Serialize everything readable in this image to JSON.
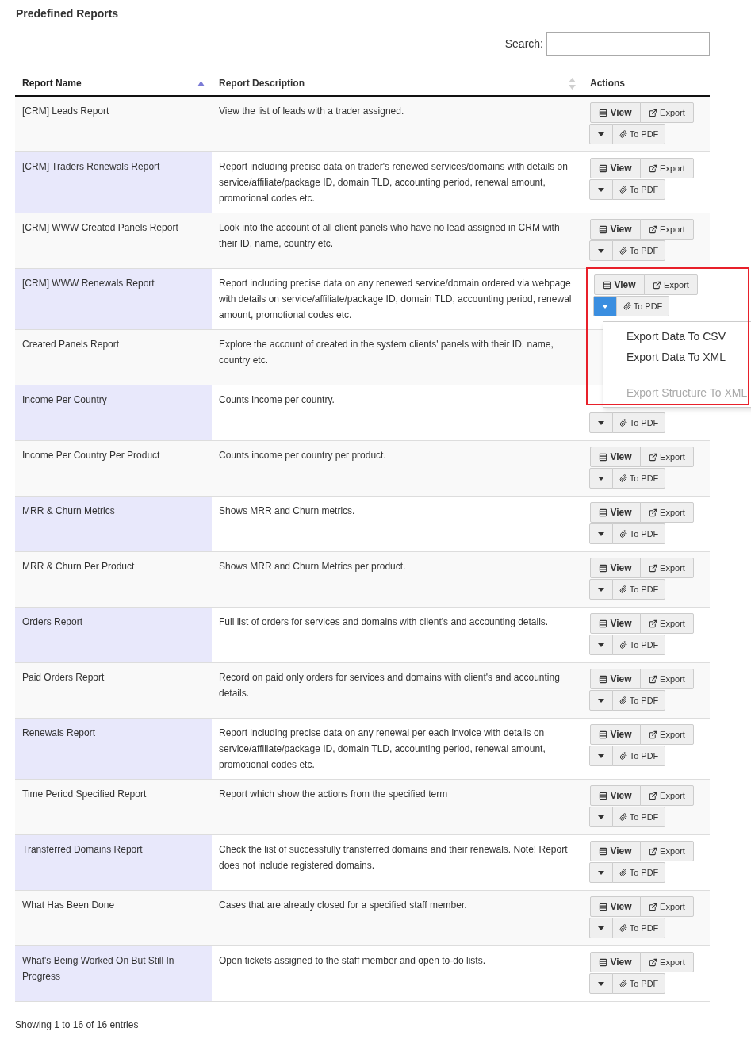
{
  "title": "Predefined Reports",
  "search": {
    "label": "Search:"
  },
  "columns": [
    {
      "label": "Report Name",
      "sortable": true,
      "sorted": true
    },
    {
      "label": "Report Description",
      "sortable": true,
      "sorted": false
    },
    {
      "label": "Actions"
    }
  ],
  "rows": [
    {
      "name": "[CRM] Leads Report",
      "description": "View the list of leads with a trader assigned.",
      "buttons": [
        {
          "kind": "view",
          "label": "View"
        },
        {
          "kind": "export",
          "label": "Export"
        },
        {
          "kind": "toggle"
        },
        {
          "kind": "pdf",
          "label": "To PDF"
        }
      ]
    },
    {
      "name": "[CRM] Traders Renewals Report",
      "description": "Report including precise data on trader's renewed services/domains with details on service/affiliate/package ID, domain TLD, accounting period, renewal amount, promotional codes etc.",
      "buttons": [
        {
          "kind": "view",
          "label": "View"
        },
        {
          "kind": "export",
          "label": "Export"
        },
        {
          "kind": "toggle"
        },
        {
          "kind": "pdf",
          "label": "To PDF"
        }
      ]
    },
    {
      "name": "[CRM] WWW Created Panels Report",
      "description": "Look into the account of all client panels who have no lead assigned in CRM with their ID, name, country etc.",
      "buttons": [
        {
          "kind": "view",
          "label": "View"
        },
        {
          "kind": "export",
          "label": "Export"
        },
        {
          "kind": "toggle"
        },
        {
          "kind": "pdf",
          "label": "To PDF"
        }
      ]
    },
    {
      "name": "[CRM] WWW Renewals Report",
      "description": "Report including precise data on any renewed service/domain ordered via webpage with details on service/affiliate/package ID, domain TLD, accounting period, renewal amount, promotional codes etc.",
      "dropdown_open": true,
      "buttons": [
        {
          "kind": "view",
          "label": "View"
        },
        {
          "kind": "export",
          "label": "Export"
        },
        {
          "kind": "toggle"
        },
        {
          "kind": "pdf",
          "label": "To PDF"
        }
      ],
      "menu": [
        {
          "label": "Export Data To CSV",
          "disabled": false
        },
        {
          "label": "Export Data To XML",
          "disabled": false
        },
        {
          "label": "Export Structure To XML",
          "disabled": true
        }
      ]
    },
    {
      "name": "Created Panels Report",
      "description": "Explore the account of created in the system clients' panels with their ID, name, country etc.",
      "buttons": []
    },
    {
      "name": "Income Per Country",
      "description": "Counts income per country.",
      "buttons": [
        {
          "kind": "toggle"
        },
        {
          "kind": "pdf",
          "label": "To PDF"
        }
      ]
    },
    {
      "name": "Income Per Country Per Product",
      "description": "Counts income per country per product.",
      "buttons": [
        {
          "kind": "view",
          "label": "View"
        },
        {
          "kind": "export",
          "label": "Export"
        },
        {
          "kind": "toggle"
        },
        {
          "kind": "pdf",
          "label": "To PDF"
        }
      ]
    },
    {
      "name": "MRR & Churn Metrics",
      "description": "Shows MRR and Churn metrics.",
      "buttons": [
        {
          "kind": "view",
          "label": "View"
        },
        {
          "kind": "export",
          "label": "Export"
        },
        {
          "kind": "toggle"
        },
        {
          "kind": "pdf",
          "label": "To PDF"
        }
      ]
    },
    {
      "name": "MRR & Churn Per Product",
      "description": "Shows MRR and Churn Metrics per product.",
      "buttons": [
        {
          "kind": "view",
          "label": "View"
        },
        {
          "kind": "export",
          "label": "Export"
        },
        {
          "kind": "toggle"
        },
        {
          "kind": "pdf",
          "label": "To PDF"
        }
      ]
    },
    {
      "name": "Orders Report",
      "description": "Full list of orders for services and domains with client's and accounting details.",
      "buttons": [
        {
          "kind": "view",
          "label": "View"
        },
        {
          "kind": "export",
          "label": "Export"
        },
        {
          "kind": "toggle"
        },
        {
          "kind": "pdf",
          "label": "To PDF"
        }
      ]
    },
    {
      "name": "Paid Orders Report",
      "description": "Record on paid only orders for services and domains with client's and accounting details.",
      "buttons": [
        {
          "kind": "view",
          "label": "View"
        },
        {
          "kind": "export",
          "label": "Export"
        },
        {
          "kind": "toggle"
        },
        {
          "kind": "pdf",
          "label": "To PDF"
        }
      ]
    },
    {
      "name": "Renewals Report",
      "description": "Report including precise data on any renewal per each invoice with details on service/affiliate/package ID, domain TLD, accounting period, renewal amount, promotional codes etc.",
      "buttons": [
        {
          "kind": "view",
          "label": "View"
        },
        {
          "kind": "export",
          "label": "Export"
        },
        {
          "kind": "toggle"
        },
        {
          "kind": "pdf",
          "label": "To PDF"
        }
      ]
    },
    {
      "name": "Time Period Specified Report",
      "description": "Report which show the actions from the specified term",
      "buttons": [
        {
          "kind": "view",
          "label": "View"
        },
        {
          "kind": "export",
          "label": "Export"
        },
        {
          "kind": "toggle"
        },
        {
          "kind": "pdf",
          "label": "To PDF"
        }
      ]
    },
    {
      "name": "Transferred Domains Report",
      "description": "Check the list of successfully transferred domains and their renewals. Note! Report does not include registered domains.",
      "buttons": [
        {
          "kind": "view",
          "label": "View"
        },
        {
          "kind": "export",
          "label": "Export"
        },
        {
          "kind": "toggle"
        },
        {
          "kind": "pdf",
          "label": "To PDF"
        }
      ]
    },
    {
      "name": "What Has Been Done",
      "description": "Cases that are already closed for a specified staff member.",
      "buttons": [
        {
          "kind": "view",
          "label": "View"
        },
        {
          "kind": "export",
          "label": "Export"
        },
        {
          "kind": "toggle"
        },
        {
          "kind": "pdf",
          "label": "To PDF"
        }
      ]
    },
    {
      "name": "What's Being Worked On But Still In Progress",
      "description": "Open tickets assigned to the staff member and open to-do lists.",
      "buttons": [
        {
          "kind": "view",
          "label": "View"
        },
        {
          "kind": "export",
          "label": "Export"
        },
        {
          "kind": "toggle"
        },
        {
          "kind": "pdf",
          "label": "To PDF"
        }
      ]
    }
  ],
  "footer": "Showing 1 to 16 of 16 entries"
}
